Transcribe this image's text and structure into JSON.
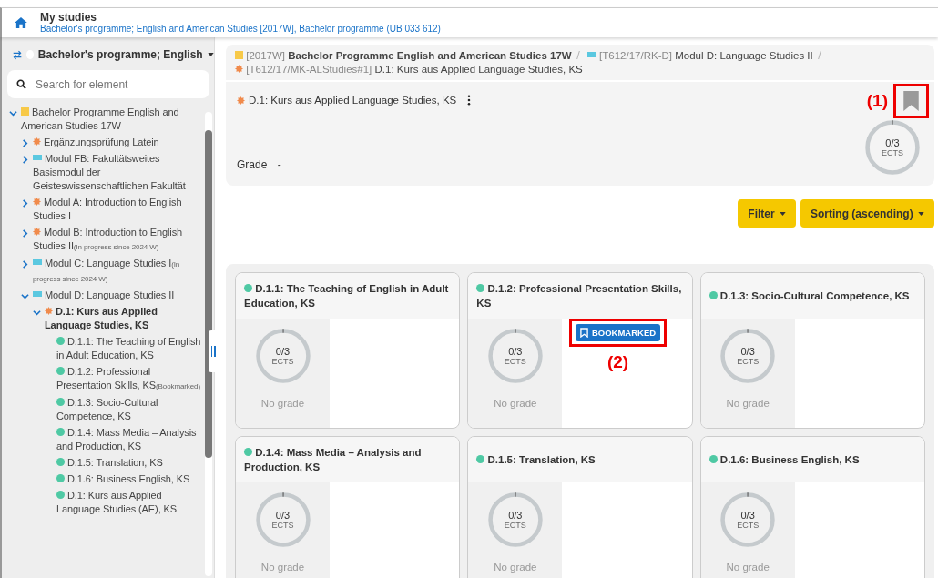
{
  "header": {
    "title": "My studies",
    "subtitle": "Bachelor's programme; English and American Studies [2017W], Bachelor programme (UB 033 612)"
  },
  "sidebar": {
    "programme_select": "Bachelor's programme; English",
    "search": {
      "placeholder": "Search for element"
    },
    "tree": [
      {
        "label": "Bachelor Programme English and American Studies 17W",
        "kind": "square",
        "expanded": true,
        "selected": false,
        "children": [
          {
            "label": "Ergänzungsprüfung Latein",
            "kind": "gear",
            "expanded": false,
            "selected": false
          },
          {
            "label": "Modul FB: Fakultätsweites Basismodul der Geisteswissenschaftlichen Fakultät",
            "kind": "rect",
            "expanded": false,
            "selected": false
          },
          {
            "label": "Modul A: Introduction to English Studies I",
            "kind": "gear",
            "expanded": false,
            "selected": false
          },
          {
            "label": "Modul B: Introduction to English Studies II",
            "note": "(In progress since 2024 W)",
            "kind": "gear",
            "expanded": false,
            "selected": false
          },
          {
            "label": "Modul C: Language Studies I",
            "note": "(In progress since 2024 W)",
            "kind": "rect",
            "expanded": false,
            "selected": false
          },
          {
            "label": "Modul D: Language Studies II",
            "kind": "rect",
            "expanded": true,
            "selected": false,
            "children": [
              {
                "label": "D.1: Kurs aus Applied Language Studies, KS",
                "kind": "gear",
                "expanded": true,
                "selected": true,
                "children": [
                  {
                    "label": "D.1.1: The Teaching of English in Adult Education, KS",
                    "kind": "dot",
                    "selected": false
                  },
                  {
                    "label": "D.1.2: Professional Presentation Skills, KS",
                    "note": "(Bookmarked)",
                    "kind": "dot",
                    "selected": false
                  },
                  {
                    "label": "D.1.3: Socio-Cultural Competence, KS",
                    "kind": "dot",
                    "selected": false
                  },
                  {
                    "label": "D.1.4: Mass Media – Analysis and Production, KS",
                    "kind": "dot",
                    "selected": false
                  },
                  {
                    "label": "D.1.5: Translation, KS",
                    "kind": "dot",
                    "selected": false
                  },
                  {
                    "label": "D.1.6: Business English, KS",
                    "kind": "dot",
                    "selected": false
                  },
                  {
                    "label": "D.1: Kurs aus Applied Language Studies (AE), KS",
                    "kind": "dot",
                    "selected": false
                  }
                ]
              }
            ]
          }
        ]
      }
    ]
  },
  "breadcrumb": [
    {
      "code": "[2017W]",
      "name": "Bachelor Programme English and American Studies 17W",
      "kind": "square",
      "bold": true
    },
    {
      "code": "[T612/17/RK-D]",
      "name": "Modul D: Language Studies II",
      "kind": "rect",
      "bold": false
    },
    {
      "code": "[T612/17/MK-ALStudies#1]",
      "name": "D.1: Kurs aus Applied Language Studies, KS",
      "kind": "gear",
      "bold": false
    }
  ],
  "detail": {
    "title": "D.1: Kurs aus Applied Language Studies, KS",
    "kind": "gear",
    "bookmarked": false,
    "ects": "0/3",
    "ects_unit": "ECTS",
    "level": 0,
    "grade_label": "Grade",
    "grade": "-",
    "callout": "(1)"
  },
  "toolbar": {
    "filter": "Filter",
    "sorting": "Sorting (ascending)"
  },
  "cards": [
    {
      "title": "D.1.1: The Teaching of English in Adult Education, KS",
      "ects": "0/3",
      "unit": "ECTS",
      "level": 0,
      "grade": "No grade",
      "bookmarked": false
    },
    {
      "title": "D.1.2: Professional Presentation Skills, KS",
      "ects": "0/3",
      "unit": "ECTS",
      "level": 0,
      "grade": "No grade",
      "bookmarked": true,
      "badge": "BOOKMARKED",
      "callout": "(2)"
    },
    {
      "title": "D.1.3: Socio-Cultural Competence, KS",
      "ects": "0/3",
      "unit": "ECTS",
      "level": 0,
      "grade": "No grade",
      "bookmarked": false
    },
    {
      "title": "D.1.4: Mass Media – Analysis and Production, KS",
      "ects": "0/3",
      "unit": "ECTS",
      "level": 0,
      "grade": "No grade",
      "bookmarked": false
    },
    {
      "title": "D.1.5: Translation, KS",
      "ects": "0/3",
      "unit": "ECTS",
      "level": 0,
      "grade": "No grade",
      "bookmarked": false
    },
    {
      "title": "D.1.6: Business English, KS",
      "ects": "0/3",
      "unit": "ECTS",
      "level": 0,
      "grade": "No grade",
      "bookmarked": false
    }
  ]
}
